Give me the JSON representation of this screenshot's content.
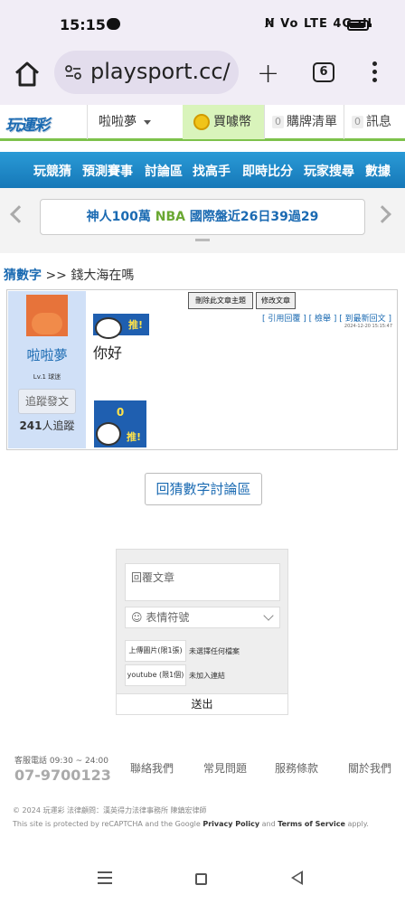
{
  "status_bar": {
    "time": "15:15",
    "icons_text": "N̸ Vo LTE 4G ıll"
  },
  "browser": {
    "url": "playsport.cc/",
    "tab_count": "6"
  },
  "site_header": {
    "logo": "玩運彩",
    "user_menu": "啦啦夢",
    "coin_label": "買噱幣",
    "cart_count": "0",
    "cart_label": "購牌清單",
    "msg_count": "0",
    "msg_label": "訊息"
  },
  "nav": [
    "玩競猜",
    "預測賽事",
    "討論區",
    "找高手",
    "即時比分",
    "玩家搜尋",
    "數據"
  ],
  "ticker": {
    "part1": "神人100萬",
    "part2": "NBA",
    "part3": "國際盤近26日39過29"
  },
  "breadcrumb": {
    "link": "猜數字",
    "sep": ">>",
    "current": "錢大海在嗎"
  },
  "post": {
    "author_name": "啦啦夢",
    "author_level": "Lv.1 球迷",
    "follow_button": "追蹤發文",
    "followers_count": "241",
    "followers_label": "人追蹤",
    "delete_button": "刪除此文章主題",
    "edit_button": "修改文章",
    "link_quote": "[ 引用回覆 ]",
    "link_report": "[ 檢舉 ]",
    "link_latest": "[ 到最新回文 ]",
    "date": "2024-12-20 15:15:47",
    "tag_label": "推!",
    "content": "你好",
    "push_count": "0",
    "push_label": "推!"
  },
  "back_button": "回猜數字討論區",
  "reply_form": {
    "text_placeholder": "回覆文章",
    "emoji_label": "表情符號",
    "upload_button": "上傳圖片(限1張)",
    "upload_status": "未選擇任何檔案",
    "youtube_button": "youtube (限1個)",
    "youtube_status": "未加入連結",
    "submit": "送出"
  },
  "footer": {
    "hotline_label": "客服電話 09:30 ~ 24:00",
    "hotline": "07-9700123",
    "links": [
      "聯絡我們",
      "常見問題",
      "服務條款",
      "關於我們"
    ],
    "copyright": "© 2024 玩運彩 法律顧問：漢英得力法律事務所 陳鎮宏律師",
    "recaptcha_1": "This site is protected by reCAPTCHA and the Google ",
    "privacy": "Privacy Policy",
    "and": " and ",
    "terms": "Terms of Service",
    "apply": " apply."
  },
  "colors": {
    "brand_blue": "#1a6ab2",
    "nav_blue": "#1e88c9",
    "accent_green": "#7dc24b",
    "ticker_red": "#c0392b"
  }
}
